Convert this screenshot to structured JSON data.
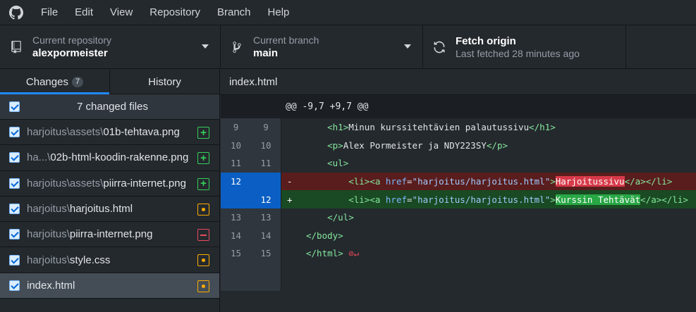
{
  "menu": [
    "File",
    "Edit",
    "View",
    "Repository",
    "Branch",
    "Help"
  ],
  "toolbar": {
    "repo_sub": "Current repository",
    "repo_main": "alexpormeister",
    "branch_sub": "Current branch",
    "branch_main": "main",
    "fetch_main": "Fetch origin",
    "fetch_sub": "Last fetched 28 minutes ago"
  },
  "tabs": {
    "changes": "Changes",
    "changes_count": "7",
    "history": "History"
  },
  "changes_header": "7 changed files",
  "files": [
    {
      "dir": "harjoitus\\assets\\",
      "name": "01b-tehtava.png",
      "status": "added"
    },
    {
      "dir": "ha...\\",
      "name": "02b-html-koodin-rakenne.png",
      "status": "added"
    },
    {
      "dir": "harjoitus\\assets\\",
      "name": "piirra-internet.png",
      "status": "added"
    },
    {
      "dir": "harjoitus\\",
      "name": "harjoitus.html",
      "status": "modified"
    },
    {
      "dir": "harjoitus\\",
      "name": "piirra-internet.png",
      "status": "deleted"
    },
    {
      "dir": "harjoitus\\",
      "name": "style.css",
      "status": "modified"
    },
    {
      "dir": "",
      "name": "index.html",
      "status": "modified"
    }
  ],
  "diff": {
    "filename": "index.html",
    "hunk": "@@ -9,7 +9,7 @@",
    "lines": [
      {
        "old": "9",
        "new": "9",
        "type": "ctx",
        "indent": "    ",
        "parts": [
          [
            "tag",
            "<h1>"
          ],
          [
            "txt",
            "Minun kurssitehtävien palautussivu"
          ],
          [
            "tag",
            "</h1>"
          ]
        ]
      },
      {
        "old": "10",
        "new": "10",
        "type": "ctx",
        "indent": "    ",
        "parts": [
          [
            "tag",
            "<p>"
          ],
          [
            "txt",
            "Alex Pormeister ja NDY223SY"
          ],
          [
            "tag",
            "</p>"
          ]
        ]
      },
      {
        "old": "11",
        "new": "11",
        "type": "ctx",
        "indent": "    ",
        "parts": [
          [
            "tag",
            "<ul>"
          ]
        ]
      },
      {
        "old": "12",
        "new": "",
        "type": "del",
        "indent": "        ",
        "parts": [
          [
            "tag",
            "<li><a "
          ],
          [
            "attr",
            "href"
          ],
          [
            "txt",
            "="
          ],
          [
            "str",
            "\"harjoitus/harjoitus.html\""
          ],
          [
            "tag",
            ">"
          ],
          [
            "hl",
            "Harjoitussivu"
          ],
          [
            "tag",
            "</a></li>"
          ]
        ]
      },
      {
        "old": "",
        "new": "12",
        "type": "add",
        "indent": "        ",
        "parts": [
          [
            "tag",
            "<li><a "
          ],
          [
            "attr",
            "href"
          ],
          [
            "txt",
            "="
          ],
          [
            "str",
            "\"harjoitus/harjoitus.html\""
          ],
          [
            "tag",
            ">"
          ],
          [
            "hl",
            "Kurssin Tehtävät"
          ],
          [
            "tag",
            "</a></li>"
          ]
        ]
      },
      {
        "old": "13",
        "new": "13",
        "type": "ctx",
        "indent": "    ",
        "parts": [
          [
            "tag",
            "</ul>"
          ]
        ]
      },
      {
        "old": "14",
        "new": "14",
        "type": "ctx",
        "indent": "",
        "parts": [
          [
            "tag",
            "</body>"
          ]
        ]
      },
      {
        "old": "15",
        "new": "15",
        "type": "ctx",
        "indent": "",
        "parts": [
          [
            "tag",
            "</html>"
          ],
          [
            "noeol",
            " ⊘↵"
          ]
        ]
      }
    ]
  },
  "colors": {
    "accent": "#2188ff",
    "added": "#34d058",
    "modified": "#ffab00",
    "deleted": "#ea4a5a"
  }
}
